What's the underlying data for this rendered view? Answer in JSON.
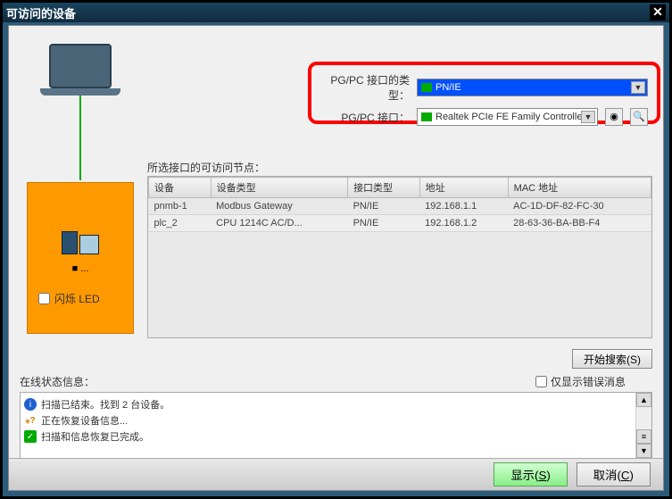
{
  "window": {
    "title": "可访问的设备"
  },
  "interface": {
    "type_label": "PG/PC 接口的类型：",
    "type_value": "PN/IE",
    "iface_label": "PG/PC 接口：",
    "iface_value": "Realtek PCIe FE Family Controller"
  },
  "device_panel": {
    "flash_led_label": "闪烁 LED",
    "flash_led_checked": false
  },
  "nodes_label": "所选接口的可访问节点：",
  "table": {
    "headers": [
      "设备",
      "设备类型",
      "接口类型",
      "地址",
      "MAC 地址"
    ],
    "rows": [
      [
        "pnmb-1",
        "Modbus Gateway",
        "PN/IE",
        "192.168.1.1",
        "AC-1D-DF-82-FC-30"
      ],
      [
        "plc_2",
        "CPU 1214C AC/D...",
        "PN/IE",
        "192.168.1.2",
        "28-63-36-BA-BB-F4"
      ]
    ]
  },
  "search_button": "开始搜索(S)",
  "search_button_key": "S",
  "status": {
    "title": "在线状态信息：",
    "error_only_label": "仅显示错误消息",
    "error_only_checked": false,
    "items": [
      {
        "icon": "info",
        "text": "扫描已结束。找到 2 台设备。"
      },
      {
        "icon": "warn",
        "text": "正在恢复设备信息..."
      },
      {
        "icon": "ok",
        "text": "扫描和信息恢复已完成。"
      }
    ]
  },
  "footer": {
    "show": "显示(S)",
    "show_key": "S",
    "cancel": "取消(C)",
    "cancel_key": "C"
  }
}
